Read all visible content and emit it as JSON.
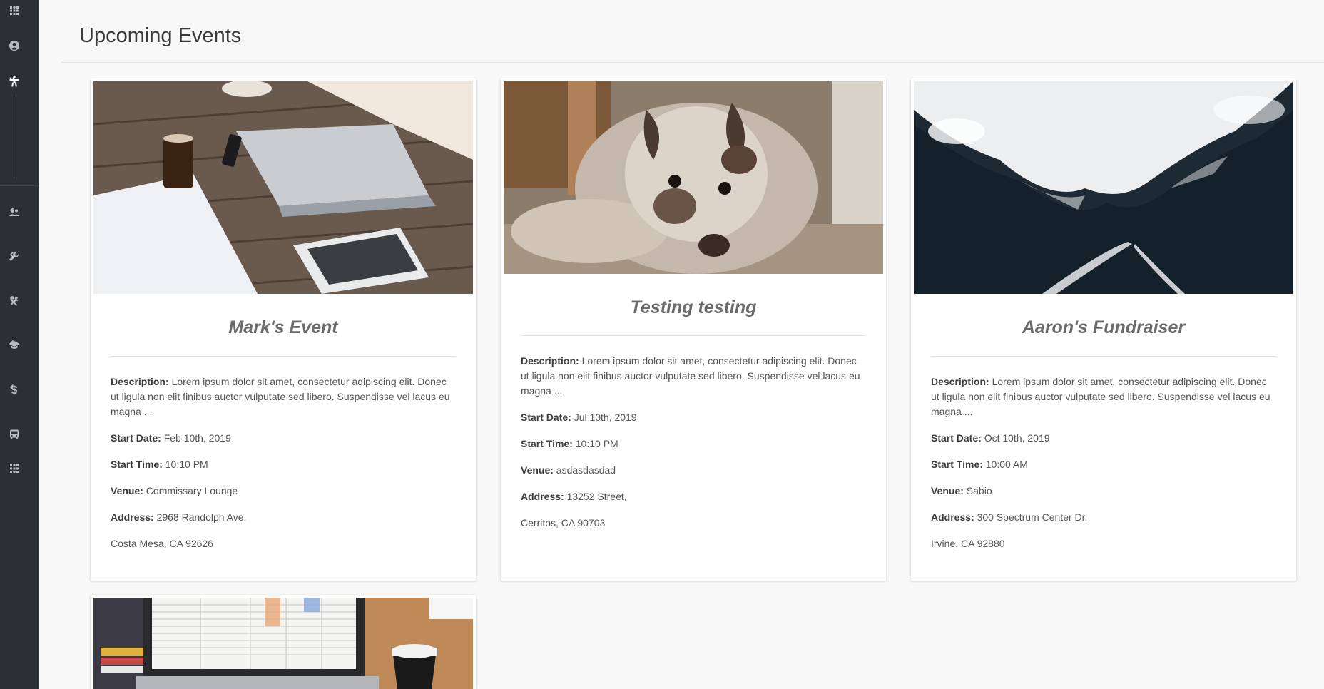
{
  "page": {
    "title": "Upcoming Events"
  },
  "sidebar": {
    "items": [
      {
        "icon": "apps-grid-icon"
      },
      {
        "icon": "account-circle-icon"
      },
      {
        "icon": "accessibility-icon"
      },
      {
        "icon": "people-icon"
      },
      {
        "icon": "wrench-icon"
      },
      {
        "icon": "tools-icon"
      },
      {
        "icon": "graduation-cap-icon"
      },
      {
        "icon": "dollar-icon"
      },
      {
        "icon": "bus-icon"
      },
      {
        "icon": "apps-grid-icon"
      }
    ]
  },
  "labels": {
    "description": "Description:",
    "start_date": "Start Date:",
    "start_time": "Start Time:",
    "venue": "Venue:",
    "address": "Address:"
  },
  "events": [
    {
      "title": "Mark's Event",
      "description": "Lorem ipsum dolor sit amet, consectetur adipiscing elit. Donec ut ligula non elit finibus auctor vulputate sed libero. Suspendisse vel lacus eu magna ...",
      "start_date": "Feb 10th, 2019",
      "start_time": "10:10 PM",
      "venue": "Commissary Lounge",
      "address_line1": "2968 Randolph Ave,",
      "address_line2": "Costa Mesa, CA 92626"
    },
    {
      "title": "Testing testing",
      "description": "Lorem ipsum dolor sit amet, consectetur adipiscing elit. Donec ut ligula non elit finibus auctor vulputate sed libero. Suspendisse vel lacus eu magna ...",
      "start_date": "Jul 10th, 2019",
      "start_time": "10:10 PM",
      "venue": "asdasdasdad",
      "address_line1": "13252 Street,",
      "address_line2": "Cerritos, CA 90703"
    },
    {
      "title": "Aaron's Fundraiser",
      "description": "Lorem ipsum dolor sit amet, consectetur adipiscing elit. Donec ut ligula non elit finibus auctor vulputate sed libero. Suspendisse vel lacus eu magna ...",
      "start_date": "Oct 10th, 2019",
      "start_time": "10:00 AM",
      "venue": "Sabio",
      "address_line1": "300 Spectrum Center Dr,",
      "address_line2": "Irvine, CA 92880"
    }
  ],
  "colors": {
    "sidebar_bg": "#2c2f33",
    "page_bg": "#f8f8f8",
    "title_text": "#6b6b6b"
  }
}
